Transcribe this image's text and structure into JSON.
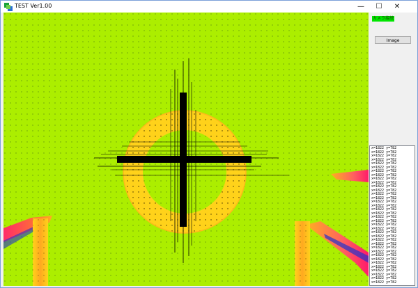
{
  "window": {
    "title": "TEST Ver1.00",
    "minimize_glyph": "—",
    "maximize_glyph": "☐",
    "close_glyph": "✕"
  },
  "camera_status": "カメラ接続",
  "image_button_label": "Image",
  "log": {
    "lines": [
      "x=1822 y=782",
      "x=1822 y=782",
      "x=1822 y=782",
      "x=1822 y=782",
      "x=1822 y=782",
      "x=1822 y=782",
      "x=1822 y=782",
      "x=1822 y=782",
      "x=1822 y=782",
      "x=1822 y=782",
      "x=1822 y=782",
      "x=1822 y=782",
      "x=1822 y=782",
      "x=1822 y=782",
      "x=1822 y=782",
      "x=1822 y=782",
      "x=1822 y=782",
      "x=1822 y=782",
      "x=1822 y=782",
      "x=1822 y=782",
      "x=1822 y=782",
      "x=1822 y=782",
      "x=1822 y=782",
      "x=1822 y=782",
      "x=1822 y=782",
      "x=1822 y=782",
      "x=1822 y=782",
      "x=1822 y=782",
      "x=1822 y=782",
      "x=1822 y=782",
      "x=1822 y=782",
      "x=1822 y=782",
      "x=1822 y=782",
      "x=1822 y=782",
      "x=1822 y=782",
      "x=1822 y=782"
    ]
  },
  "colors": {
    "background": "#acee00",
    "ring": "#ffd21a",
    "crosshair": "#000000",
    "status_bg": "#00e600"
  }
}
